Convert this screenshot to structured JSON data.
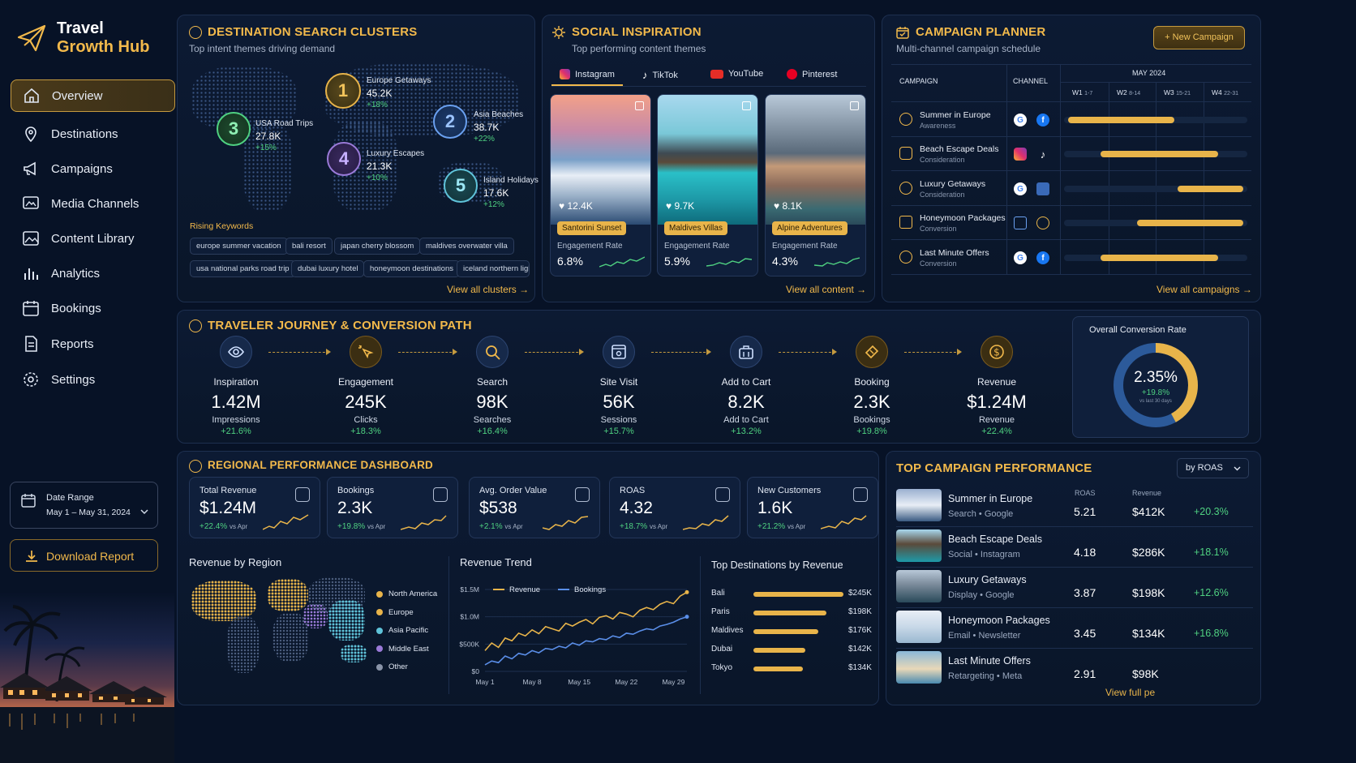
{
  "app": {
    "title_line1": "Travel",
    "title_line2": "Growth Hub"
  },
  "sidebar": {
    "items": [
      {
        "label": "Overview",
        "icon": "home-icon"
      },
      {
        "label": "Destinations",
        "icon": "map-pin-icon"
      },
      {
        "label": "Campaigns",
        "icon": "megaphone-icon"
      },
      {
        "label": "Media Channels",
        "icon": "media-icon"
      },
      {
        "label": "Content Library",
        "icon": "image-icon"
      },
      {
        "label": "Analytics",
        "icon": "bar-chart-icon"
      },
      {
        "label": "Bookings",
        "icon": "calendar-icon"
      },
      {
        "label": "Reports",
        "icon": "document-icon"
      },
      {
        "label": "Settings",
        "icon": "gear-icon"
      }
    ],
    "date_range_label": "Date Range",
    "date_range_value": "May 1 – May 31, 2024",
    "download_label": "Download Report"
  },
  "clusters": {
    "title": "DESTINATION SEARCH CLUSTERS",
    "subtitle": "Top intent themes driving demand",
    "items": [
      {
        "rank": "1",
        "name": "Europe Getaways",
        "value": "45.2K",
        "change": "+18%"
      },
      {
        "rank": "2",
        "name": "Asia Beaches",
        "value": "38.7K",
        "change": "+22%"
      },
      {
        "rank": "3",
        "name": "USA Road Trips",
        "value": "27.8K",
        "change": "+15%"
      },
      {
        "rank": "4",
        "name": "Luxury Escapes",
        "value": "21.3K",
        "change": "+10%"
      },
      {
        "rank": "5",
        "name": "Island Holidays",
        "value": "17.6K",
        "change": "+12%"
      }
    ],
    "rising_label": "Rising Keywords",
    "keywords": [
      "europe summer vacation",
      "bali resort",
      "japan cherry blossom",
      "maldives overwater villa",
      "usa national parks road trip",
      "dubai luxury hotel",
      "honeymoon destinations",
      "iceland northern ligh"
    ],
    "link": "View all clusters →"
  },
  "social": {
    "title": "SOCIAL INSPIRATION",
    "subtitle": "Top performing content themes",
    "tabs": [
      "Instagram",
      "TikTok",
      "YouTube",
      "Pinterest"
    ],
    "cards": [
      {
        "likes": "12.4K",
        "tag": "Santorini Sunset",
        "er_label": "Engagement Rate",
        "er": "6.8%"
      },
      {
        "likes": "9.7K",
        "tag": "Maldives Villas",
        "er_label": "Engagement Rate",
        "er": "5.9%"
      },
      {
        "likes": "8.1K",
        "tag": "Alpine Adventures",
        "er_label": "Engagement Rate",
        "er": "4.3%"
      }
    ],
    "link": "View all content →"
  },
  "planner": {
    "title": "CAMPAIGN PLANNER",
    "subtitle": "Multi-channel campaign schedule",
    "new_button": "+ New Campaign",
    "col_campaign": "CAMPAIGN",
    "col_channel": "CHANNEL",
    "month": "MAY 2024",
    "weeks": [
      {
        "w": "W1",
        "d": "1-7"
      },
      {
        "w": "W2",
        "d": "8-14"
      },
      {
        "w": "W3",
        "d": "15-21"
      },
      {
        "w": "W4",
        "d": "22-31"
      }
    ],
    "rows": [
      {
        "name": "Summer in Europe",
        "stage": "Awareness",
        "start": 0.02,
        "end": 0.6
      },
      {
        "name": "Beach Escape Deals",
        "stage": "Consideration",
        "start": 0.2,
        "end": 0.84
      },
      {
        "name": "Luxury Getaways",
        "stage": "Consideration",
        "start": 0.62,
        "end": 0.98
      },
      {
        "name": "Honeymoon Packages",
        "stage": "Conversion",
        "start": 0.4,
        "end": 0.98
      },
      {
        "name": "Last Minute Offers",
        "stage": "Conversion",
        "start": 0.2,
        "end": 0.84
      }
    ],
    "link": "View all campaigns →"
  },
  "journey": {
    "title": "TRAVELER JOURNEY & CONVERSION PATH",
    "steps": [
      {
        "name": "Inspiration",
        "value": "1.42M",
        "unit": "Impressions",
        "change": "+21.6%",
        "icon": "eye-icon"
      },
      {
        "name": "Engagement",
        "value": "245K",
        "unit": "Clicks",
        "change": "+18.3%",
        "icon": "cursor-click-icon"
      },
      {
        "name": "Search",
        "value": "98K",
        "unit": "Searches",
        "change": "+16.4%",
        "icon": "search-icon"
      },
      {
        "name": "Site Visit",
        "value": "56K",
        "unit": "Sessions",
        "change": "+15.7%",
        "icon": "browser-icon"
      },
      {
        "name": "Add to Cart",
        "value": "8.2K",
        "unit": "Add to Cart",
        "change": "+13.2%",
        "icon": "bag-icon"
      },
      {
        "name": "Booking",
        "value": "2.3K",
        "unit": "Bookings",
        "change": "+19.8%",
        "icon": "ticket-icon"
      },
      {
        "name": "Revenue",
        "value": "$1.24M",
        "unit": "Revenue",
        "change": "+22.4%",
        "icon": "dollar-icon"
      }
    ],
    "overall_label": "Overall Conversion Rate",
    "overall_value": "2.35%",
    "overall_change": "+19.8%",
    "overall_note": "vs last 30 days",
    "overall_fill": 0.42
  },
  "regional": {
    "title": "REGIONAL PERFORMANCE DASHBOARD",
    "kpis": [
      {
        "label": "Total Revenue",
        "value": "$1.24M",
        "change": "+22.4%",
        "note": "vs Apr"
      },
      {
        "label": "Bookings",
        "value": "2.3K",
        "change": "+19.8%",
        "note": "vs Apr"
      },
      {
        "label": "Avg. Order Value",
        "value": "$538",
        "change": "+2.1%",
        "note": "vs Apr"
      },
      {
        "label": "ROAS",
        "value": "4.32",
        "change": "+18.7%",
        "note": "vs Apr"
      },
      {
        "label": "New Customers",
        "value": "1.6K",
        "change": "+21.2%",
        "note": "vs Apr"
      }
    ],
    "region_title": "Revenue by Region",
    "regions": [
      {
        "name": "North America",
        "color": "#e8b44a"
      },
      {
        "name": "Europe",
        "color": "#e8b44a"
      },
      {
        "name": "Asia Pacific",
        "color": "#5fc3d9"
      },
      {
        "name": "Middle East",
        "color": "#9a7ad8"
      },
      {
        "name": "Other",
        "color": "#8a94a8"
      }
    ],
    "trend_title": "Revenue Trend",
    "dest_title": "Top Destinations by Revenue"
  },
  "chart_data": [
    {
      "type": "line",
      "title": "Revenue Trend",
      "x": [
        "May 1",
        "May 2",
        "May 3",
        "May 4",
        "May 5",
        "May 6",
        "May 7",
        "May 8",
        "May 9",
        "May 10",
        "May 11",
        "May 12",
        "May 13",
        "May 14",
        "May 15",
        "May 16",
        "May 17",
        "May 18",
        "May 19",
        "May 20",
        "May 21",
        "May 22",
        "May 23",
        "May 24",
        "May 25",
        "May 26",
        "May 27",
        "May 28",
        "May 29",
        "May 30",
        "May 31"
      ],
      "xticks": [
        "May 1",
        "May 8",
        "May 15",
        "May 22",
        "May 29"
      ],
      "yticks": [
        "$0",
        "$500K",
        "$1.0M",
        "$1.5M"
      ],
      "ylim": [
        0,
        1500000
      ],
      "series": [
        {
          "name": "Revenue",
          "color": "#e8b44a",
          "values": [
            380000,
            520000,
            440000,
            610000,
            560000,
            700000,
            650000,
            760000,
            690000,
            820000,
            780000,
            740000,
            880000,
            830000,
            900000,
            950000,
            870000,
            990000,
            1020000,
            960000,
            1080000,
            1050000,
            1000000,
            1120000,
            1170000,
            1130000,
            1230000,
            1280000,
            1240000,
            1380000,
            1450000
          ]
        },
        {
          "name": "Bookings",
          "color": "#5a8ee8",
          "values": [
            120000,
            190000,
            160000,
            280000,
            230000,
            330000,
            300000,
            380000,
            340000,
            420000,
            400000,
            460000,
            430000,
            520000,
            480000,
            560000,
            540000,
            600000,
            580000,
            650000,
            620000,
            700000,
            680000,
            740000,
            780000,
            760000,
            830000,
            860000,
            900000,
            960000,
            1000000
          ]
        }
      ]
    },
    {
      "type": "bar",
      "title": "Top Destinations by Revenue",
      "categories": [
        "Bali",
        "Paris",
        "Maldives",
        "Dubai",
        "Tokyo"
      ],
      "values": [
        245,
        198,
        176,
        142,
        134
      ],
      "value_labels": [
        "$245K",
        "$198K",
        "$176K",
        "$142K",
        "$134K"
      ],
      "unit": "K"
    }
  ],
  "top_campaigns": {
    "title": "TOP CAMPAIGN PERFORMANCE",
    "sort": "by ROAS",
    "col_roas": "ROAS",
    "col_revenue": "Revenue",
    "rows": [
      {
        "name": "Summer in Europe",
        "sub": "Search • Google",
        "roas": "5.21",
        "revenue": "$412K",
        "change": "+20.3%"
      },
      {
        "name": "Beach Escape Deals",
        "sub": "Social • Instagram",
        "roas": "4.18",
        "revenue": "$286K",
        "change": "+18.1%"
      },
      {
        "name": "Luxury Getaways",
        "sub": "Display • Google",
        "roas": "3.87",
        "revenue": "$198K",
        "change": "+12.6%"
      },
      {
        "name": "Honeymoon Packages",
        "sub": "Email • Newsletter",
        "roas": "3.45",
        "revenue": "$134K",
        "change": "+16.8%"
      },
      {
        "name": "Last Minute Offers",
        "sub": "Retargeting • Meta",
        "roas": "2.91",
        "revenue": "$98K",
        "change": ""
      }
    ],
    "link": "View full pe"
  }
}
